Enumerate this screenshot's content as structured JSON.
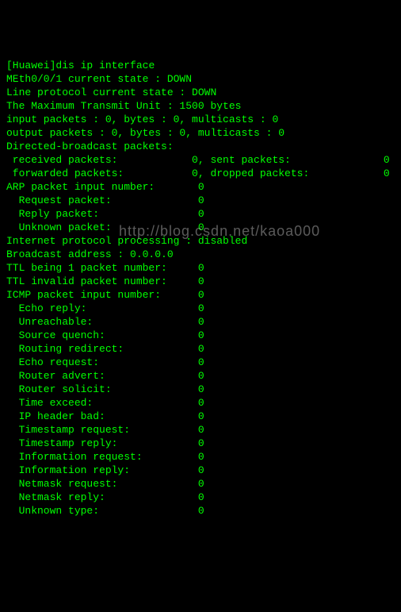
{
  "prompt": "[Huawei]",
  "command": "dis ip interface",
  "lines": {
    "l1": "MEth0/0/1 current state : DOWN",
    "l2": "Line protocol current state : DOWN",
    "l3": "The Maximum Transmit Unit : 1500 bytes",
    "l4": "input packets : 0, bytes : 0, multicasts : 0",
    "l5": "output packets : 0, bytes : 0, multicasts : 0",
    "l6": "Directed-broadcast packets:",
    "l7": " received packets:            0, sent packets:               0",
    "l8": " forwarded packets:           0, dropped packets:            0",
    "l9": "ARP packet input number:       0",
    "l10": "  Request packet:              0",
    "l11": "  Reply packet:                0",
    "l12": "  Unknown packet:              0",
    "l13": "Internet protocol processing : disabled",
    "l14": "Broadcast address : 0.0.0.0",
    "l15": "TTL being 1 packet number:     0",
    "l16": "TTL invalid packet number:     0",
    "l17": "ICMP packet input number:      0",
    "l18": "  Echo reply:                  0",
    "l19": "  Unreachable:                 0",
    "l20": "  Source quench:               0",
    "l21": "  Routing redirect:            0",
    "l22": "  Echo request:                0",
    "l23": "  Router advert:               0",
    "l24": "  Router solicit:              0",
    "l25": "  Time exceed:                 0",
    "l26": "  IP header bad:               0",
    "l27": "  Timestamp request:           0",
    "l28": "  Timestamp reply:             0",
    "l29": "  Information request:         0",
    "l30": "  Information reply:           0",
    "l31": "  Netmask request:             0",
    "l32": "  Netmask reply:               0",
    "l33": "  Unknown type:                0"
  },
  "watermark": "http://blog.csdn.net/kaoa000"
}
